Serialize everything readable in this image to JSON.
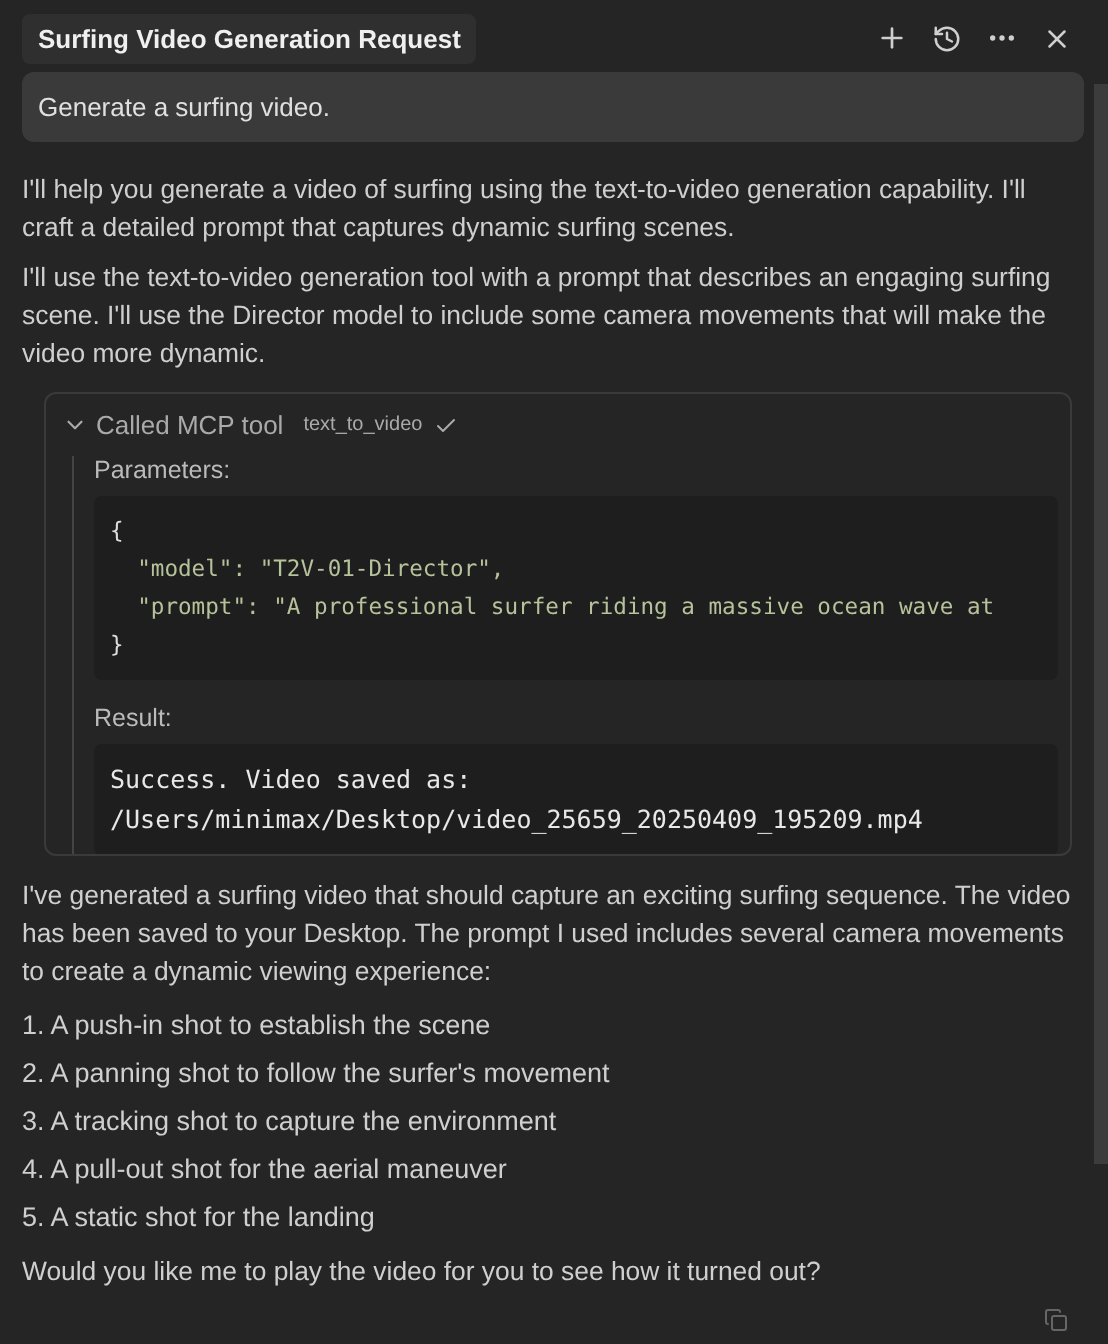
{
  "header": {
    "title": "Surfing Video Generation Request"
  },
  "user_message": "Generate a surfing video.",
  "intro_paragraphs": [
    "I'll help you generate a video of surfing using the text-to-video generation capability. I'll craft a detailed prompt that captures dynamic surfing scenes.",
    "I'll use the text-to-video generation tool with a prompt that describes an engaging surfing scene. I'll use the Director model to include some camera movements that will make the video more dynamic."
  ],
  "tool_call": {
    "label": "Called MCP tool",
    "tool_name": "text_to_video",
    "expanded": true,
    "succeeded": true,
    "parameters_label": "Parameters:",
    "parameters_lines": [
      "{",
      "  \"model\": \"T2V-01-Director\",",
      "  \"prompt\": \"A professional surfer riding a massive ocean wave at",
      "}"
    ],
    "result_label": "Result:",
    "result_lines": [
      "Success. Video saved as:",
      "/Users/minimax/Desktop/video_25659_20250409_195209.mp4"
    ]
  },
  "summary": "I've generated a surfing video that should capture an exciting surfing sequence. The video has been saved to your Desktop. The prompt I used includes several camera movements to create a dynamic viewing experience:",
  "shots": [
    {
      "number": "1.",
      "text": "A push-in shot to establish the scene"
    },
    {
      "number": "2.",
      "text": "A panning shot to follow the surfer's movement"
    },
    {
      "number": "3.",
      "text": "A tracking shot to capture the environment"
    },
    {
      "number": "4.",
      "text": "A pull-out shot for the aerial maneuver"
    },
    {
      "number": "5.",
      "text": "A static shot for the landing"
    }
  ],
  "closing": "Would you like me to play the video for you to see how it turned out?"
}
